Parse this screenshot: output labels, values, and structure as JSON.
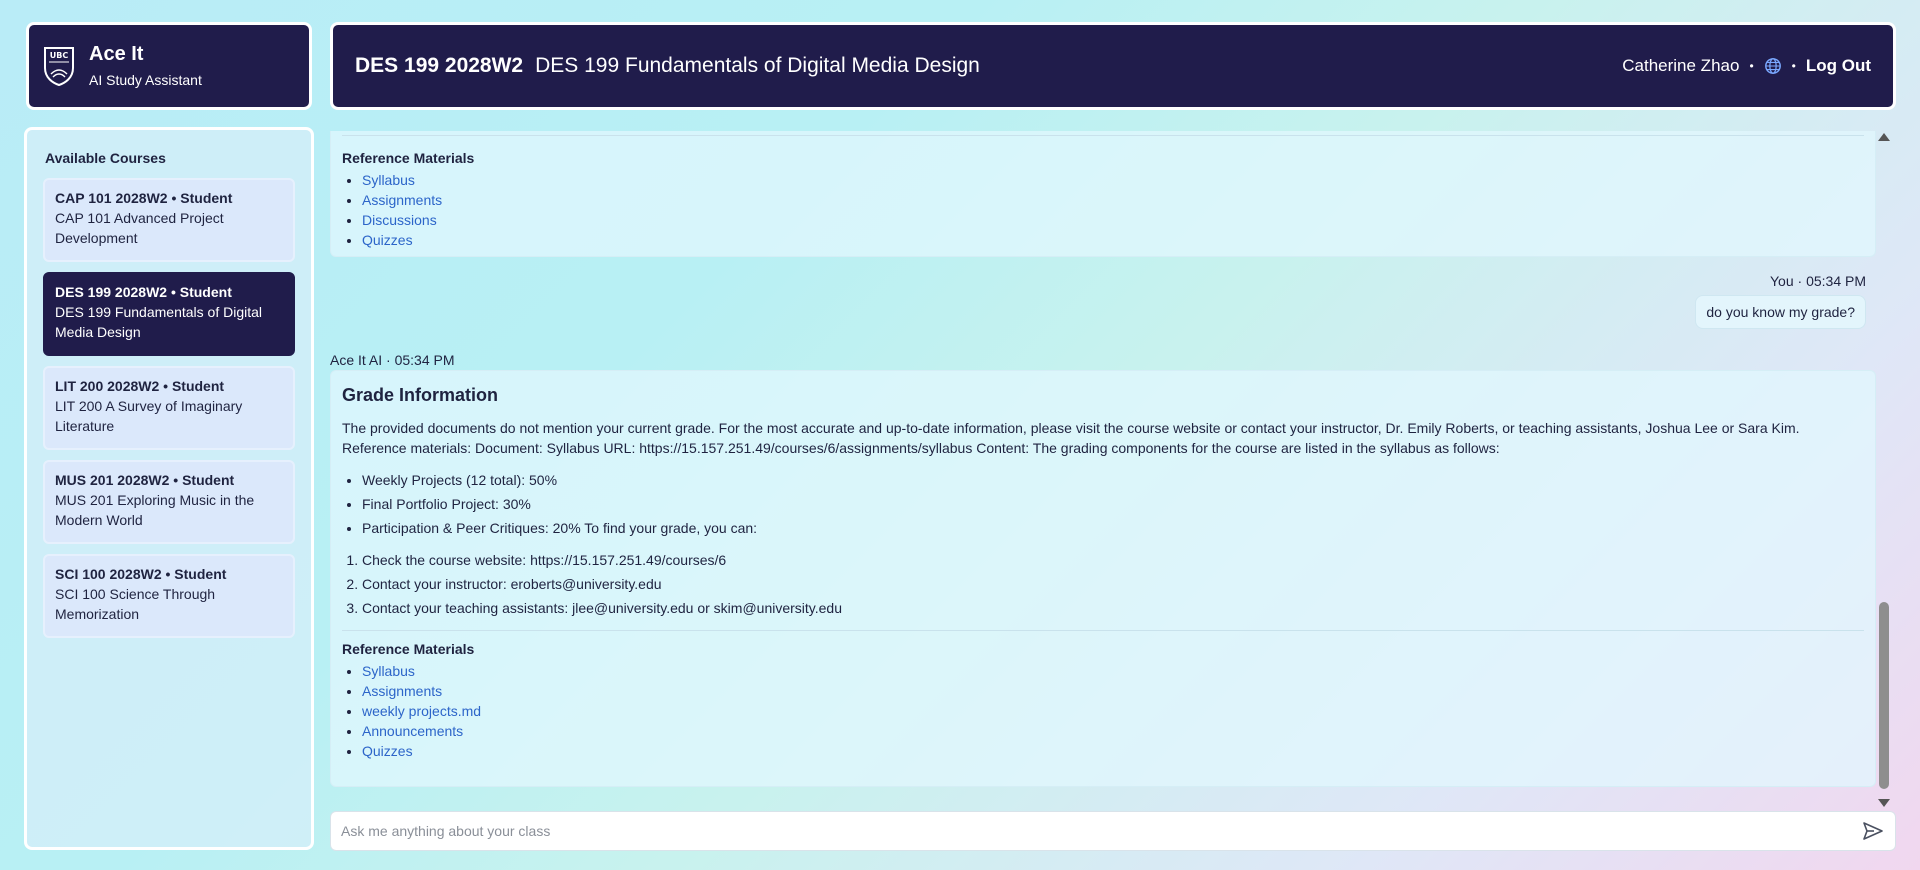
{
  "brand": {
    "name": "Ace It",
    "subtitle": "AI Study Assistant"
  },
  "header": {
    "course_code": "DES 199 2028W2",
    "course_name": "DES 199 Fundamentals of Digital Media Design",
    "user_name": "Catherine Zhao",
    "logout_label": "Log Out",
    "separator": "•"
  },
  "sidebar": {
    "title": "Available Courses",
    "courses": [
      {
        "code": "CAP 101 2028W2 • Student",
        "name": "CAP 101 Advanced Project Development"
      },
      {
        "code": "DES 199 2028W2 • Student",
        "name": "DES 199 Fundamentals of Digital Media Design"
      },
      {
        "code": "LIT 200 2028W2 • Student",
        "name": "LIT 200 A Survey of Imaginary Literature"
      },
      {
        "code": "MUS 201 2028W2 • Student",
        "name": "MUS 201 Exploring Music in the Modern World"
      },
      {
        "code": "SCI 100 2028W2 • Student",
        "name": "SCI 100 Science Through Memorization"
      }
    ]
  },
  "chat": {
    "prev_refs": {
      "title": "Reference Materials",
      "items": [
        "Syllabus",
        "Assignments",
        "Discussions",
        "Quizzes"
      ]
    },
    "user_message": {
      "meta": "You · 05:34 PM",
      "text": "do you know my grade?"
    },
    "ai_message": {
      "meta": "Ace It AI · 05:34 PM",
      "title": "Grade Information",
      "paragraph": "The provided documents do not mention your current grade. For the most accurate and up-to-date information, please visit the course website or contact your instructor, Dr. Emily Roberts, or teaching assistants, Joshua Lee or Sara Kim. Reference materials: Document: Syllabus URL: https://15.157.251.49/courses/6/assignments/syllabus Content: The grading components for the course are listed in the syllabus as follows:",
      "bullets": [
        "Weekly Projects (12 total): 50%",
        "Final Portfolio Project: 30%",
        "Participation & Peer Critiques: 20% To find your grade, you can:"
      ],
      "steps": [
        "Check the course website: https://15.157.251.49/courses/6",
        "Contact your instructor: eroberts@university.edu",
        "Contact your teaching assistants: jlee@university.edu or skim@university.edu"
      ],
      "refs_title": "Reference Materials",
      "refs": [
        "Syllabus",
        "Assignments",
        "weekly projects.md",
        "Announcements",
        "Quizzes"
      ]
    }
  },
  "input": {
    "placeholder": "Ask me anything about your class"
  },
  "colors": {
    "navy": "#201c4b",
    "link": "#2c65c9"
  }
}
